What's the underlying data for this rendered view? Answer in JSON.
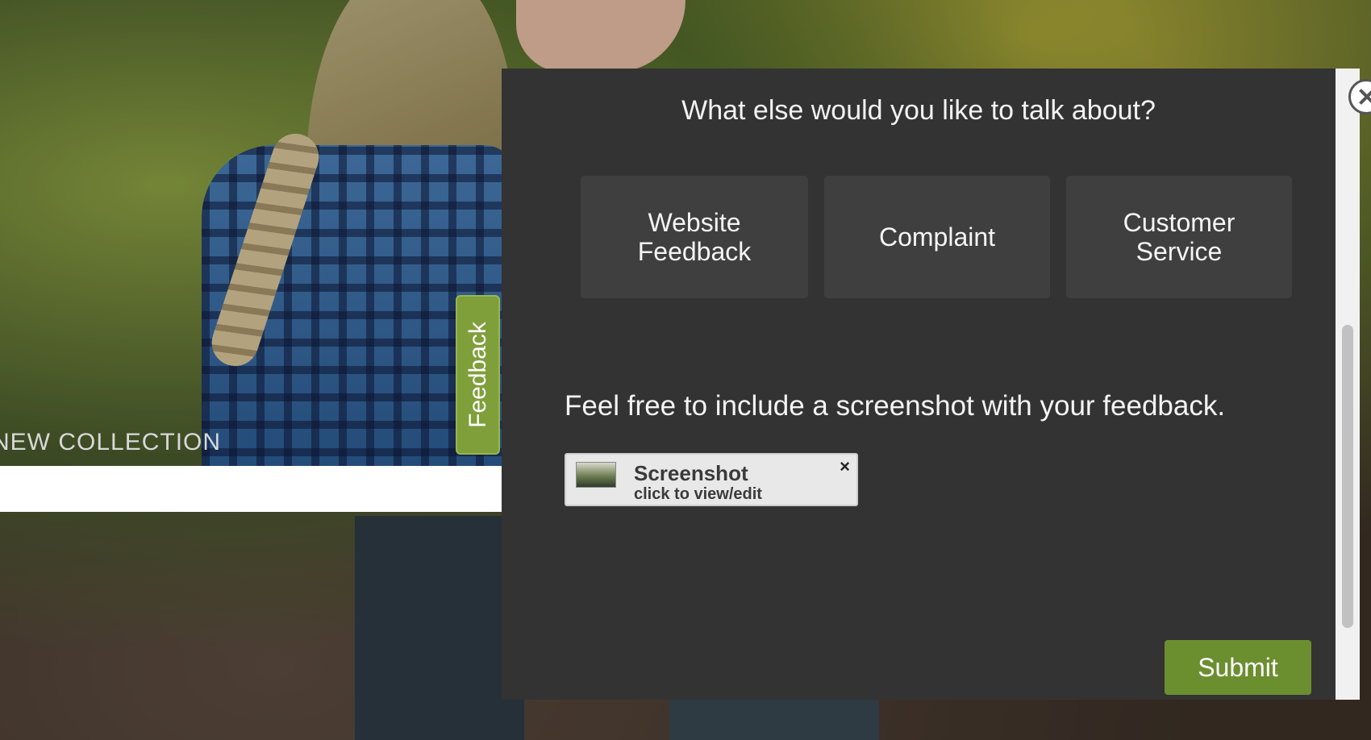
{
  "background": {
    "collection_label": "NEW COLLECTION"
  },
  "feedback_tab": {
    "label": "Feedback"
  },
  "dialog": {
    "title": "What else would you like to talk about?",
    "options": [
      {
        "line1": "Website",
        "line2": "Feedback"
      },
      {
        "line1": "Complaint",
        "line2": ""
      },
      {
        "line1": "Customer",
        "line2": "Service"
      }
    ],
    "screenshot_prompt": "Feel free to include a screenshot with your feedback.",
    "screenshot_chip": {
      "title": "Screenshot",
      "subtitle": "click to view/edit",
      "close_glyph": "×"
    },
    "submit_label": "Submit"
  },
  "colors": {
    "panel_bg": "#333333",
    "option_bg": "#3f3f3f",
    "accent_green": "#6b8e2f",
    "feedback_tab_green": "#7f9f3b"
  },
  "icons": {
    "close": "close-icon",
    "thumbnail": "screenshot-thumbnail"
  }
}
